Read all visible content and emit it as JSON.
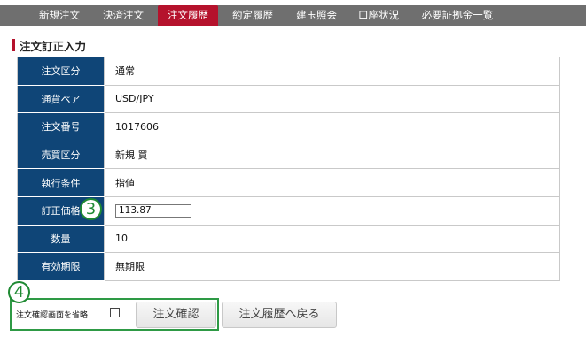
{
  "nav": {
    "items": [
      {
        "label": "新規注文"
      },
      {
        "label": "決済注文"
      },
      {
        "label": "注文履歴",
        "active": true
      },
      {
        "label": "約定履歴"
      },
      {
        "label": "建玉照会"
      },
      {
        "label": "口座状況"
      },
      {
        "label": "必要証拠金一覧"
      }
    ],
    "active_color": "#b5122c",
    "bar_color": "#6f6f6f"
  },
  "section": {
    "title": "注文訂正入力"
  },
  "form": {
    "label_color": "#0f4577",
    "rows": [
      {
        "label": "注文区分",
        "value": "通常"
      },
      {
        "label": "通貨ペア",
        "value": "USD/JPY"
      },
      {
        "label": "注文番号",
        "value": "1017606"
      },
      {
        "label": "売買区分",
        "value": "新規 買"
      },
      {
        "label": "執行条件",
        "value": "指値"
      },
      {
        "label": "訂正価格",
        "input_value": "113.87"
      },
      {
        "label": "数量",
        "value": "10"
      },
      {
        "label": "有効期限",
        "value": "無期限"
      }
    ]
  },
  "annotations": {
    "badge_3": "3",
    "badge_4": "4",
    "color": "#1f8a33"
  },
  "actions": {
    "skip_confirm_label": "注文確認画面を省略",
    "skip_confirm_checked": false,
    "confirm_button": "注文確認",
    "back_button": "注文履歴へ戻る"
  }
}
